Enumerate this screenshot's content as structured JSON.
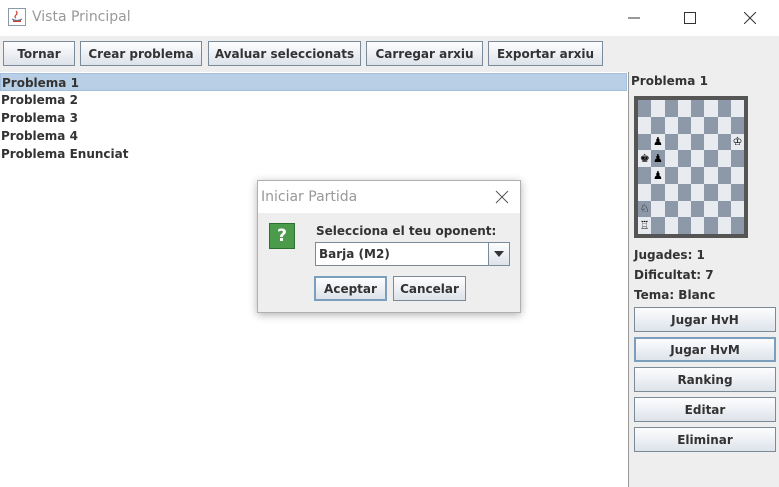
{
  "window": {
    "title": "Vista Principal"
  },
  "toolbar": {
    "buttons": [
      "Tornar",
      "Crear problema",
      "Avaluar seleccionats",
      "Carregar arxiu",
      "Exportar arxiu"
    ]
  },
  "list": {
    "items": [
      "Problema 1",
      "Problema 2",
      "Problema 3",
      "Problema 4",
      "Problema Enunciat"
    ],
    "selected_index": 0
  },
  "side": {
    "heading": "Problema 1",
    "board": {
      "pieces": [
        {
          "row": 2,
          "col": 1,
          "glyph": "♟",
          "icon": "black-pawn-icon"
        },
        {
          "row": 2,
          "col": 7,
          "glyph": "♔",
          "icon": "white-king-icon"
        },
        {
          "row": 3,
          "col": 0,
          "glyph": "♚",
          "icon": "black-king-icon"
        },
        {
          "row": 3,
          "col": 1,
          "glyph": "♟",
          "icon": "black-pawn-icon"
        },
        {
          "row": 4,
          "col": 1,
          "glyph": "♟",
          "icon": "black-pawn-icon"
        },
        {
          "row": 6,
          "col": 0,
          "glyph": "♘",
          "icon": "white-knight-icon"
        },
        {
          "row": 7,
          "col": 0,
          "glyph": "♖",
          "icon": "white-rook-icon"
        }
      ]
    },
    "moves": "Jugades: 1",
    "difficulty": "Dificultat: 7",
    "theme": "Tema: Blanc",
    "buttons": {
      "hvh": "Jugar HvH",
      "hvm": "Jugar HvM",
      "ranking": "Ranking",
      "edit": "Editar",
      "delete": "Eliminar"
    }
  },
  "dialog": {
    "title": "Iniciar Partida",
    "question_icon": "?",
    "label": "Selecciona el teu oponent:",
    "combo_value": "Barja (M2)",
    "accept": "Aceptar",
    "cancel": "Cancelar"
  },
  "colors": {
    "selection": "#b8cfe5",
    "board_dark": "#8d99a8",
    "board_light": "#e8ecf0",
    "question_green": "#4c9a4c"
  }
}
